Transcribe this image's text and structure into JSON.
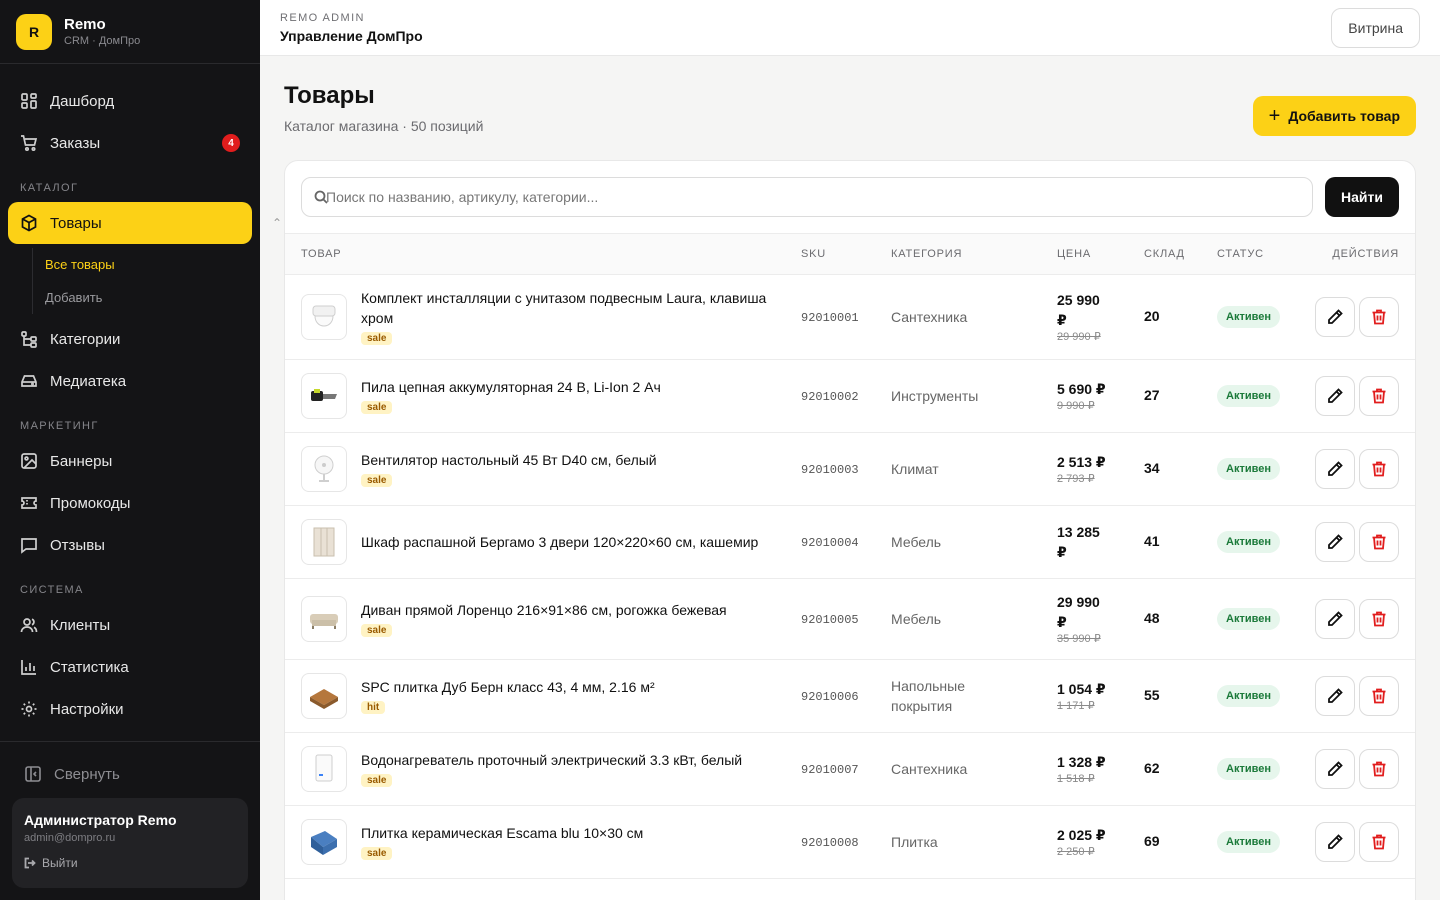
{
  "brand": {
    "logo_letter": "R",
    "name": "Remo",
    "subtitle": "CRM · ДомПро"
  },
  "sidebar": {
    "main": [
      {
        "label": "Дашборд",
        "icon": "dashboard-icon"
      },
      {
        "label": "Заказы",
        "icon": "cart-icon",
        "badge": "4"
      }
    ],
    "catalog_label": "КАТАЛОГ",
    "catalog": {
      "products": "Товары",
      "sub_all": "Все товары",
      "sub_add": "Добавить",
      "categories": "Категории",
      "media": "Медиатека"
    },
    "marketing_label": "МАРКЕТИНГ",
    "marketing": {
      "banners": "Баннеры",
      "promocodes": "Промокоды",
      "reviews": "Отзывы"
    },
    "system_label": "СИСТЕМА",
    "system": {
      "clients": "Клиенты",
      "stats": "Статистика",
      "settings": "Настройки"
    },
    "collapse": "Свернуть",
    "user": {
      "name": "Администратор Remo",
      "email": "admin@dompro.ru",
      "logout": "Выйти"
    }
  },
  "topbar": {
    "kicker": "REMO ADMIN",
    "title": "Управление ДомПро",
    "storefront": "Витрина"
  },
  "page": {
    "title": "Товары",
    "subtitle": "Каталог магазина · 50 позиций",
    "add_button": "Добавить товар",
    "search_placeholder": "Поиск по названию, артикулу, категории...",
    "search_button": "Найти"
  },
  "table": {
    "headers": [
      "ТОВАР",
      "SKU",
      "КАТЕГОРИЯ",
      "ЦЕНА",
      "СКЛАД",
      "СТАТУС",
      "ДЕЙСТВИЯ"
    ],
    "rows": [
      {
        "name": "Комплект инсталляции с унитазом подвесным Laura, клавиша хром",
        "tag": "sale",
        "sku": "92010001",
        "category": "Сантехника",
        "price": "25 990 ₽",
        "old_price": "29 990 ₽",
        "stock": "20",
        "status": "Активен",
        "thumb": "toilet-thumb"
      },
      {
        "name": "Пила цепная аккумуляторная 24 В, Li-Ion 2 Ач",
        "tag": "sale",
        "sku": "92010002",
        "category": "Инструменты",
        "price": "5 690 ₽",
        "old_price": "9 990 ₽",
        "stock": "27",
        "status": "Активен",
        "thumb": "chainsaw-thumb"
      },
      {
        "name": "Вентилятор настольный 45 Вт D40 см, белый",
        "tag": "sale",
        "sku": "92010003",
        "category": "Климат",
        "price": "2 513 ₽",
        "old_price": "2 793 ₽",
        "stock": "34",
        "status": "Активен",
        "thumb": "fan-thumb"
      },
      {
        "name": "Шкаф распашной Бергамо 3 двери 120×220×60 см, кашемир",
        "tag": "",
        "sku": "92010004",
        "category": "Мебель",
        "price": "13 285 ₽",
        "old_price": "",
        "stock": "41",
        "status": "Активен",
        "thumb": "wardrobe-thumb"
      },
      {
        "name": "Диван прямой Лоренцо 216×91×86 см, рогожка бежевая",
        "tag": "sale",
        "sku": "92010005",
        "category": "Мебель",
        "price": "29 990 ₽",
        "old_price": "35 990 ₽",
        "stock": "48",
        "status": "Активен",
        "thumb": "sofa-thumb"
      },
      {
        "name": "SPC плитка Дуб Берн класс 43, 4 мм, 2.16 м²",
        "tag": "hit",
        "sku": "92010006",
        "category": "Напольные покрытия",
        "price": "1 054 ₽",
        "old_price": "1 171 ₽",
        "stock": "55",
        "status": "Активен",
        "thumb": "flooring-thumb"
      },
      {
        "name": "Водонагреватель проточный электрический 3.3 кВт, белый",
        "tag": "sale",
        "sku": "92010007",
        "category": "Сантехника",
        "price": "1 328 ₽",
        "old_price": "1 518 ₽",
        "stock": "62",
        "status": "Активен",
        "thumb": "heater-thumb"
      },
      {
        "name": "Плитка керамическая Escama blu 10×30 см",
        "tag": "sale",
        "sku": "92010008",
        "category": "Плитка",
        "price": "2 025 ₽",
        "old_price": "2 250 ₽",
        "stock": "69",
        "status": "Активен",
        "thumb": "tile-thumb"
      }
    ]
  },
  "colors": {
    "accent": "#fcd116",
    "sidebar_bg": "#141416",
    "danger": "#e11d1d",
    "success": "#1b7a3a"
  }
}
